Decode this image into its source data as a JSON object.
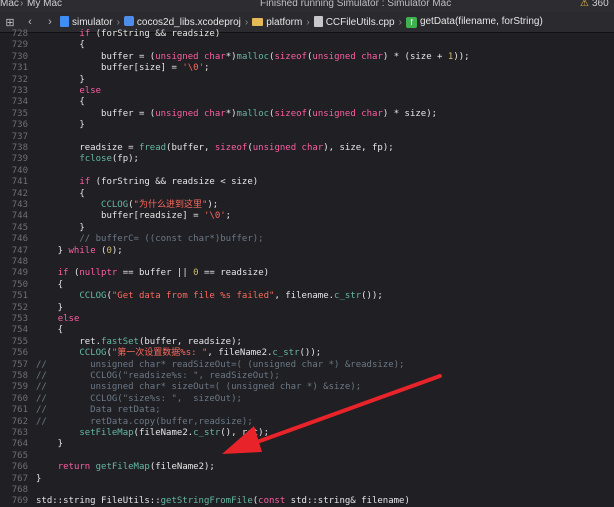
{
  "window": {
    "device_label": "Mac",
    "scheme_label": "My Mac",
    "status_text": "Finished running Simulator : Simulator Mac",
    "warning_count": "360"
  },
  "breadcrumb": {
    "items": [
      "simulator",
      "cocos2d_libs.xcodeproj",
      "platform",
      "CCFileUtils.cpp",
      "getData(filename, forString)"
    ]
  },
  "code_lines": [
    {
      "n": "728",
      "t": "        if (forString && readsize)"
    },
    {
      "n": "729",
      "t": "        {"
    },
    {
      "n": "730",
      "t": "            buffer = (unsigned char*)malloc(sizeof(unsigned char) * (size + 1));"
    },
    {
      "n": "731",
      "t": "            buffer[size] = '\\0';"
    },
    {
      "n": "732",
      "t": "        }"
    },
    {
      "n": "733",
      "t": "        else"
    },
    {
      "n": "734",
      "t": "        {"
    },
    {
      "n": "735",
      "t": "            buffer = (unsigned char*)malloc(sizeof(unsigned char) * size);"
    },
    {
      "n": "736",
      "t": "        }"
    },
    {
      "n": "737",
      "t": ""
    },
    {
      "n": "738",
      "t": "        readsize = fread(buffer, sizeof(unsigned char), size, fp);"
    },
    {
      "n": "739",
      "t": "        fclose(fp);"
    },
    {
      "n": "740",
      "t": ""
    },
    {
      "n": "741",
      "t": "        if (forString && readsize < size)"
    },
    {
      "n": "742",
      "t": "        {"
    },
    {
      "n": "743",
      "t": "            CCLOG(\"为什么进到这里\");"
    },
    {
      "n": "744",
      "t": "            buffer[readsize] = '\\0';"
    },
    {
      "n": "745",
      "t": "        }"
    },
    {
      "n": "746",
      "t": "        // bufferC= ((const char*)buffer);"
    },
    {
      "n": "747",
      "t": "    } while (0);"
    },
    {
      "n": "748",
      "t": ""
    },
    {
      "n": "749",
      "t": "    if (nullptr == buffer || 0 == readsize)"
    },
    {
      "n": "750",
      "t": "    {"
    },
    {
      "n": "751",
      "t": "        CCLOG(\"Get data from file %s failed\", filename.c_str());"
    },
    {
      "n": "752",
      "t": "    }"
    },
    {
      "n": "753",
      "t": "    else"
    },
    {
      "n": "754",
      "t": "    {"
    },
    {
      "n": "755",
      "t": "        ret.fastSet(buffer, readsize);"
    },
    {
      "n": "756",
      "t": "        CCLOG(\"第一次设置数据%s: \", fileName2.c_str());"
    },
    {
      "n": "757",
      "t": "//        unsigned char* readSizeOut=( (unsigned char *) &readsize);"
    },
    {
      "n": "758",
      "t": "//        CCLOG(\"readsize%s: \", readSizeOut);"
    },
    {
      "n": "759",
      "t": "//        unsigned char* sizeOut=( (unsigned char *) &size);"
    },
    {
      "n": "760",
      "t": "//        CCLOG(\"size%s: \",  sizeOut);"
    },
    {
      "n": "761",
      "t": "//        Data retData;"
    },
    {
      "n": "762",
      "t": "//        retData.copy(buffer,readsize);"
    },
    {
      "n": "763",
      "t": "        setFileMap(fileName2.c_str(), ret);"
    },
    {
      "n": "764",
      "t": "    }"
    },
    {
      "n": "765",
      "t": ""
    },
    {
      "n": "766",
      "t": "    return getFileMap(fileName2);"
    },
    {
      "n": "767",
      "t": "}"
    },
    {
      "n": "768",
      "t": ""
    },
    {
      "n": "769",
      "t": "std::string FileUtils::getStringFromFile(const std::string& filename)"
    }
  ],
  "colors": {
    "keyword": "#fc5fa3",
    "string": "#fc6a5d",
    "function": "#67b7a4",
    "number": "#d0bf69",
    "comment": "#6c7986",
    "arrow": "#e8232a"
  }
}
